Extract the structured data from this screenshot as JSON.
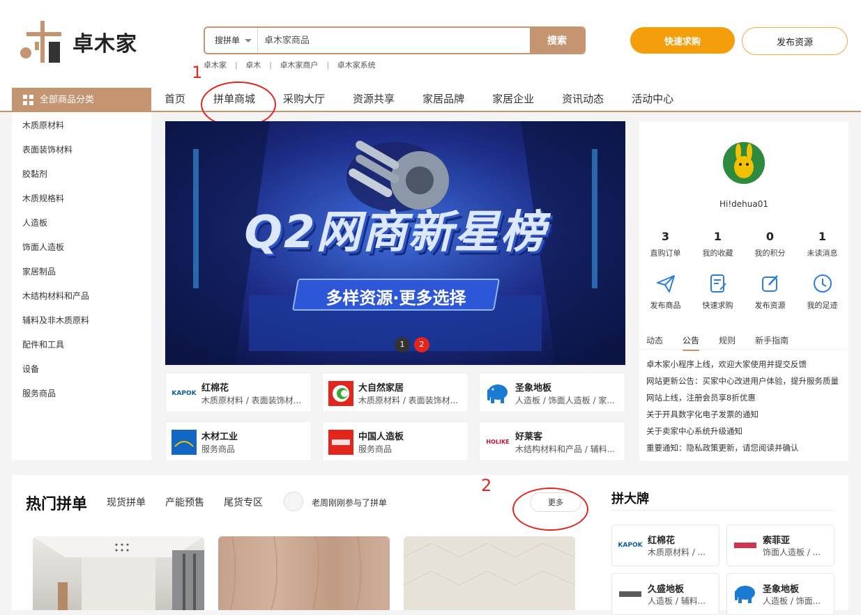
{
  "logo": {
    "text": "卓木家"
  },
  "search": {
    "type_label": "搜拼单",
    "placeholder": "卓木家商品",
    "button": "搜索",
    "hot_words": [
      "卓木家",
      "卓木",
      "卓木家商户",
      "卓木家系统"
    ]
  },
  "header_buttons": {
    "quick_purchase": "快速求购",
    "publish_resource": "发布资源"
  },
  "nav": {
    "all_categories": "全部商品分类",
    "items": [
      "首页",
      "拼单商城",
      "采购大厅",
      "资源共享",
      "家居品牌",
      "家居企业",
      "资讯动态",
      "活动中心"
    ]
  },
  "annotations": {
    "one": "1",
    "two": "2"
  },
  "categories": [
    "木质原材料",
    "表面装饰材料",
    "胶黏剂",
    "木质规格料",
    "人造板",
    "饰面人造板",
    "家居制品",
    "木结构材料和产品",
    "辅料及非木质原料",
    "配件和工具",
    "设备",
    "服务商品"
  ],
  "banner": {
    "headline": "Q2网商新星榜",
    "subline": "多样资源·更多选择",
    "dots": [
      "1",
      "2"
    ]
  },
  "brands": [
    {
      "name": "红棉花",
      "cat": "木质原材料 / 表面装饰材...",
      "logo_text": "KAPOK"
    },
    {
      "name": "大自然家居",
      "cat": "木质原材料 / 表面装饰材..."
    },
    {
      "name": "圣象地板",
      "cat": "人造板 / 饰面人造板 / 家..."
    },
    {
      "name": "木材工业",
      "cat": "服务商品"
    },
    {
      "name": "中国人造板",
      "cat": "服务商品"
    },
    {
      "name": "好莱客",
      "cat": "木结构材料和产品 / 辅料...",
      "logo_text": "HOLIKE"
    }
  ],
  "user": {
    "greeting": "Hi!dehua01",
    "stats": [
      {
        "num": "3",
        "label": "直购订单"
      },
      {
        "num": "1",
        "label": "我的收藏"
      },
      {
        "num": "0",
        "label": "我的积分"
      },
      {
        "num": "1",
        "label": "未读消息"
      }
    ],
    "actions": [
      "发布商品",
      "快速求购",
      "发布资源",
      "我的足迹"
    ],
    "tabs": [
      "动态",
      "公告",
      "规则",
      "新手指南"
    ],
    "notices": [
      "卓木家小程序上线，欢迎大家使用并提交反馈",
      "网站更新公告：买家中心改进用户体验，提升服务质量",
      "网站上线，注册会员享8折优惠",
      "关于开具数字化电子发票的通知",
      "关于卖家中心系统升级通知",
      "重要通知：隐私政策更新，请您阅读并确认"
    ]
  },
  "hot_group": {
    "title": "热门拼单",
    "tabs": [
      "现货拼单",
      "产能预售",
      "尾货专区"
    ],
    "joined_text": "老周刚刚参与了拼单",
    "more": "更多"
  },
  "pin_brand": {
    "title": "拼大牌",
    "brands": [
      {
        "name": "红棉花",
        "cat": "木质原材料 / ...",
        "logo_text": "KAPOK"
      },
      {
        "name": "索菲亚",
        "cat": "饰面人造板 / ..."
      },
      {
        "name": "久盛地板",
        "cat": "人造板 / 辅料..."
      },
      {
        "name": "圣象地板",
        "cat": "人造板 / 饰面..."
      }
    ]
  },
  "colors": {
    "brand": "#c59572",
    "accent": "#f59e0b",
    "annotation": "#e3261d"
  }
}
